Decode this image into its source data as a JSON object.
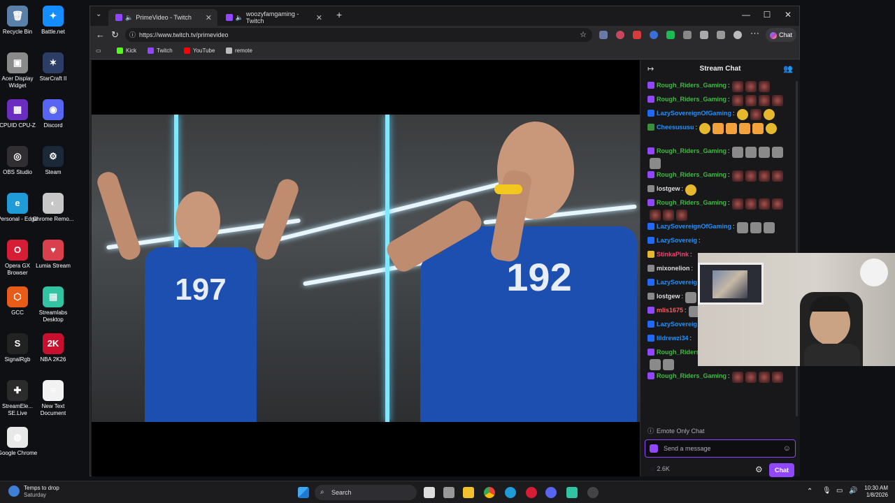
{
  "desktop_icons": [
    {
      "label": "Recycle Bin",
      "color": "#5a7fa8",
      "glyph": "🗑"
    },
    {
      "label": "Battle.net",
      "color": "#148eff",
      "glyph": "✦"
    },
    {
      "label": "Acer Display Widget",
      "color": "#8a8a8a",
      "glyph": "▣"
    },
    {
      "label": "StarCraft II",
      "color": "#2c3e66",
      "glyph": "✶"
    },
    {
      "label": "CPUID CPU-Z",
      "color": "#6a2dc0",
      "glyph": "▦"
    },
    {
      "label": "Discord",
      "color": "#5865f2",
      "glyph": "◉"
    },
    {
      "label": "OBS Studio",
      "color": "#302e31",
      "glyph": "◎"
    },
    {
      "label": "Steam",
      "color": "#1b2838",
      "glyph": "⚙"
    },
    {
      "label": "Personal - Edge",
      "color": "#1f9bd8",
      "glyph": "e"
    },
    {
      "label": "Chrome Remo...",
      "color": "#c7c7c7",
      "glyph": "◐"
    },
    {
      "label": "Opera GX Browser",
      "color": "#d71d36",
      "glyph": "O"
    },
    {
      "label": "Lumia Stream",
      "color": "#d93f4c",
      "glyph": "♥"
    },
    {
      "label": "GCC",
      "color": "#e85c1a",
      "glyph": "⬡"
    },
    {
      "label": "Streamlabs Desktop",
      "color": "#31c3a2",
      "glyph": "▤"
    },
    {
      "label": "SignalRgb",
      "color": "#222",
      "glyph": "S"
    },
    {
      "label": "NBA 2K26",
      "color": "#c8102e",
      "glyph": "2K"
    },
    {
      "label": "StreamEle... SE.Live",
      "color": "#2b2b2b",
      "glyph": "✚"
    },
    {
      "label": "New Text Document",
      "color": "#f2f2f2",
      "glyph": "≡"
    },
    {
      "label": "Google Chrome",
      "color": "#e8e8e8",
      "glyph": "◍"
    }
  ],
  "browser": {
    "tabs": [
      {
        "label": "PrimeVideo - Twitch",
        "active": true
      },
      {
        "label": "woozyfamgaming - Twitch",
        "active": false
      }
    ],
    "new_tab": "+",
    "url": "https://www.twitch.tv/primevideo",
    "copilot_label": "Chat",
    "favorites": [
      {
        "label": "Kick",
        "color": "#53fc18"
      },
      {
        "label": "Twitch",
        "color": "#9146ff"
      },
      {
        "label": "YouTube",
        "color": "#ff0000"
      },
      {
        "label": "remote",
        "color": "#bbbbbb"
      }
    ]
  },
  "player": {
    "jersey_left": "197",
    "jersey_right": "192"
  },
  "chat": {
    "title": "Stream Chat",
    "messages": [
      {
        "user": "Rough_Riders_Gaming",
        "color": "#3fba3f",
        "badge": "#9146ff",
        "emotes": [
          "red",
          "red",
          "red"
        ]
      },
      {
        "user": "Rough_Riders_Gaming",
        "color": "#3fba3f",
        "badge": "#9146ff",
        "emotes": [
          "red",
          "red",
          "red",
          "red"
        ]
      },
      {
        "user": "LazySovereignOfGaming",
        "color": "#1e90ff",
        "badge": "#1f69ff",
        "emotes": [
          "gold",
          "red",
          "gold"
        ]
      },
      {
        "user": "Cheesususu",
        "color": "#1e90ff",
        "badge": "#3a8f3a",
        "emotes": [
          "gold",
          "orange",
          "orange",
          "orange",
          "orange",
          "gold"
        ]
      },
      {
        "user": "Rough_Riders_Gaming",
        "color": "#3fba3f",
        "badge": "#9146ff",
        "emotes": [
          "gray",
          "gray",
          "gray",
          "gray",
          "gray"
        ]
      },
      {
        "user": "Rough_Riders_Gaming",
        "color": "#3fba3f",
        "badge": "#9146ff",
        "emotes": [
          "red",
          "red",
          "red",
          "red"
        ]
      },
      {
        "user": "lostgew",
        "color": "#dddddd",
        "badge": "#888888",
        "emotes": [
          "gold"
        ]
      },
      {
        "user": "Rough_Riders_Gaming",
        "color": "#3fba3f",
        "badge": "#9146ff",
        "emotes": [
          "red",
          "red",
          "red",
          "red",
          "red",
          "red",
          "red"
        ]
      },
      {
        "user": "LazySovereignOfGaming",
        "color": "#1e90ff",
        "badge": "#1f69ff",
        "emotes": [
          "gray",
          "gray",
          "gray"
        ]
      },
      {
        "user": "LazySovereig",
        "color": "#1e90ff",
        "badge": "#1f69ff",
        "emotes": []
      },
      {
        "user": "StinkaPink",
        "color": "#ff3e6e",
        "badge": "#e6b82e",
        "emotes": []
      },
      {
        "user": "mixonelion",
        "color": "#dddddd",
        "badge": "#888888",
        "emotes": []
      },
      {
        "user": "LazySovereig",
        "color": "#1e90ff",
        "badge": "#1f69ff",
        "emotes": []
      },
      {
        "user": "lostgew",
        "color": "#dddddd",
        "badge": "#888888",
        "emotes": [
          "gray"
        ]
      },
      {
        "user": "mlis1675",
        "color": "#ff5a5a",
        "badge": "#9146ff",
        "emotes": [
          "gray"
        ]
      },
      {
        "user": "LazySovereig",
        "color": "#1e90ff",
        "badge": "#1f69ff",
        "emotes": []
      },
      {
        "user": "lildrewzi34",
        "color": "#1e90ff",
        "badge": "#1f69ff",
        "emotes": []
      },
      {
        "user": "Rough_Riders_Gaming",
        "color": "#3fba3f",
        "badge": "#9146ff",
        "emotes": [
          "gray",
          "gray",
          "gray",
          "gray",
          "gray",
          "gray"
        ]
      },
      {
        "user": "Rough_Riders_Gaming",
        "color": "#3fba3f",
        "badge": "#9146ff",
        "emotes": [
          "red",
          "red",
          "red",
          "red"
        ]
      }
    ],
    "emote_only_label": "Emote Only Chat",
    "placeholder": "Send a message",
    "viewer_points": "2.6K",
    "chat_button": "Chat"
  },
  "taskbar": {
    "weather_title": "Temps to drop",
    "weather_sub": "Saturday",
    "search_placeholder": "Search",
    "time": "10:30 AM",
    "date": "1/8/2026"
  }
}
